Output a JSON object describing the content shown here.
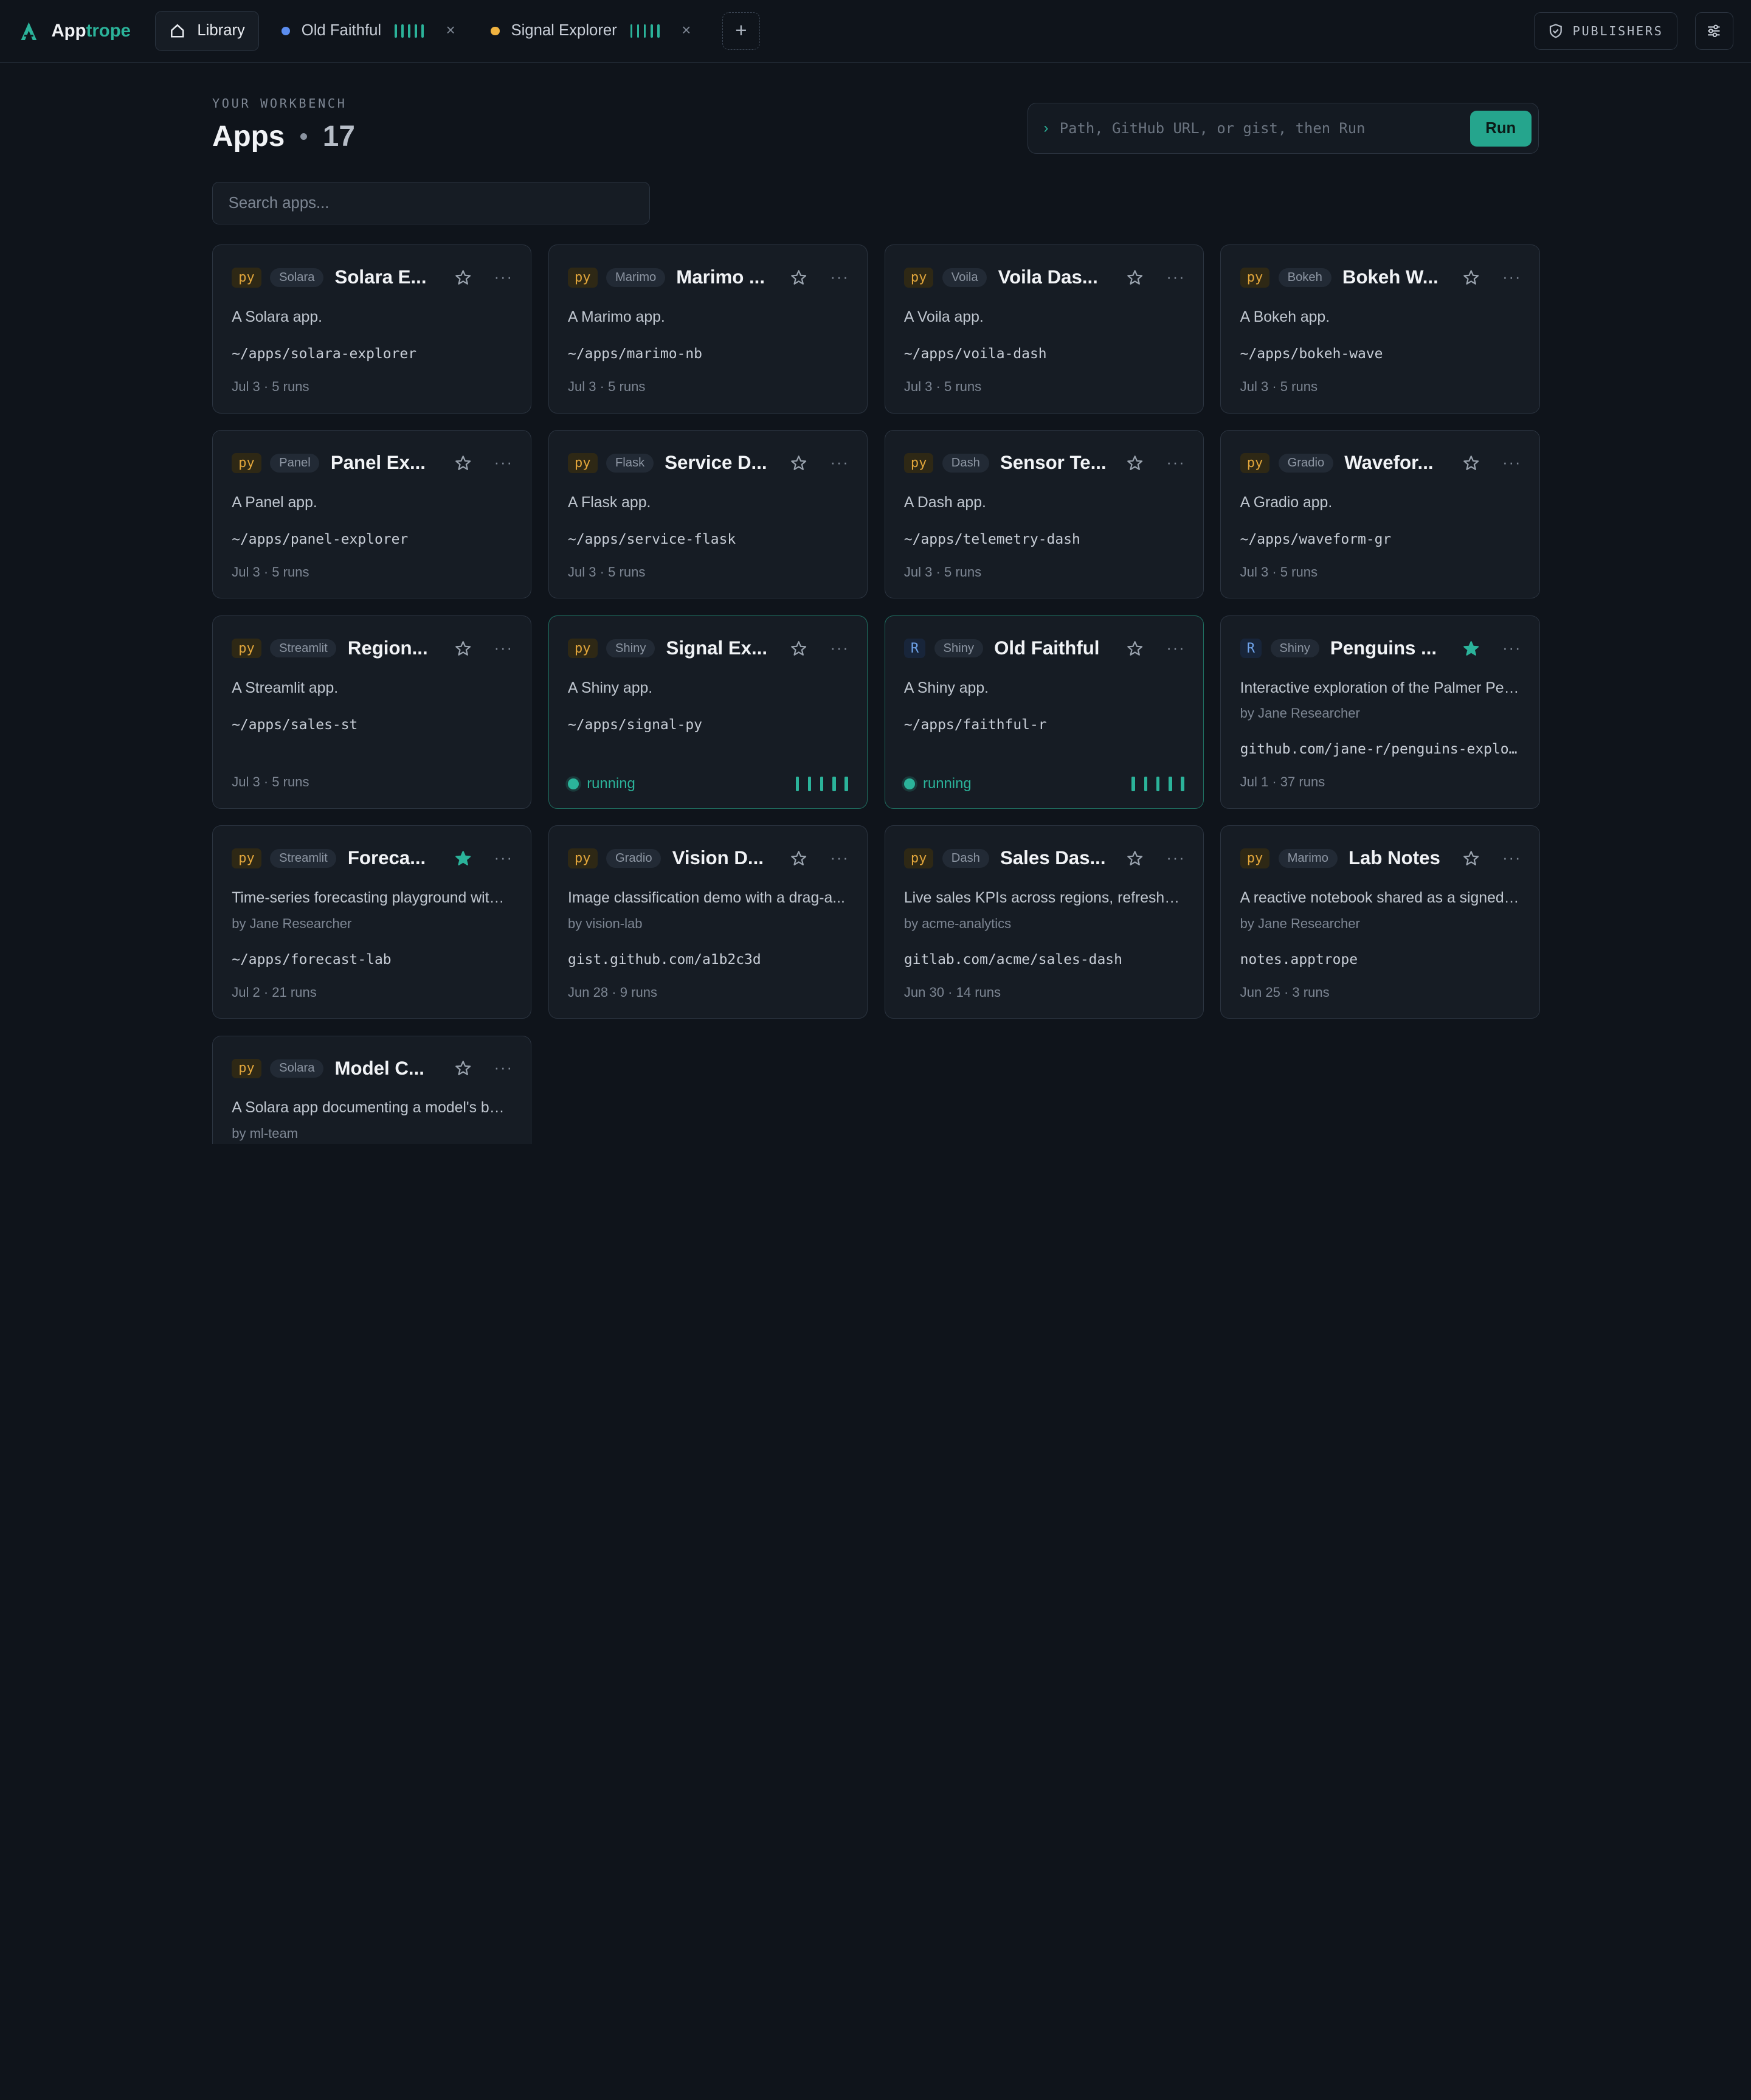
{
  "brand": {
    "name_prefix": "App",
    "name_accent": "trope"
  },
  "tabs": [
    {
      "label": "Library",
      "kind": "home"
    },
    {
      "label": "Old Faithful",
      "dot_color": "#5b8def",
      "close": "×"
    },
    {
      "label": "Signal Explorer",
      "dot_color": "#f0b340",
      "close": "×"
    }
  ],
  "tab_add": "+",
  "publishers_label": "PUBLISHERS",
  "header": {
    "eyebrow": "YOUR WORKBENCH",
    "title": "Apps",
    "count": "17"
  },
  "runbox": {
    "prompt": "›",
    "placeholder": "Path, GitHub URL, or gist, then Run",
    "button": "Run"
  },
  "search": {
    "placeholder": "Search apps..."
  },
  "colors": {
    "accent": "#2bb39a",
    "py": "#e2a63b",
    "r": "#6fa3ea"
  },
  "cards": [
    {
      "lang": "py",
      "framework": "Solara",
      "title": "Solara E...",
      "starred": false,
      "desc": "A Solara app.",
      "path": "~/apps/solara-explorer",
      "meta": "Jul 3 · 5 runs"
    },
    {
      "lang": "py",
      "framework": "Marimo",
      "title": "Marimo ...",
      "starred": false,
      "desc": "A Marimo app.",
      "path": "~/apps/marimo-nb",
      "meta": "Jul 3 · 5 runs"
    },
    {
      "lang": "py",
      "framework": "Voila",
      "title": "Voila Das...",
      "starred": false,
      "desc": "A Voila app.",
      "path": "~/apps/voila-dash",
      "meta": "Jul 3 · 5 runs"
    },
    {
      "lang": "py",
      "framework": "Bokeh",
      "title": "Bokeh W...",
      "starred": false,
      "desc": "A Bokeh app.",
      "path": "~/apps/bokeh-wave",
      "meta": "Jul 3 · 5 runs"
    },
    {
      "lang": "py",
      "framework": "Panel",
      "title": "Panel Ex...",
      "starred": false,
      "desc": "A Panel app.",
      "path": "~/apps/panel-explorer",
      "meta": "Jul 3 · 5 runs"
    },
    {
      "lang": "py",
      "framework": "Flask",
      "title": "Service D...",
      "starred": false,
      "desc": "A Flask app.",
      "path": "~/apps/service-flask",
      "meta": "Jul 3 · 5 runs"
    },
    {
      "lang": "py",
      "framework": "Dash",
      "title": "Sensor Te...",
      "starred": false,
      "desc": "A Dash app.",
      "path": "~/apps/telemetry-dash",
      "meta": "Jul 3 · 5 runs"
    },
    {
      "lang": "py",
      "framework": "Gradio",
      "title": "Wavefor...",
      "starred": false,
      "desc": "A Gradio app.",
      "path": "~/apps/waveform-gr",
      "meta": "Jul 3 · 5 runs"
    },
    {
      "lang": "py",
      "framework": "Streamlit",
      "title": "Region...",
      "starred": false,
      "desc": "A Streamlit app.",
      "path": "~/apps/sales-st",
      "meta": "Jul 3 · 5 runs"
    },
    {
      "lang": "py",
      "framework": "Shiny",
      "title": "Signal Ex...",
      "starred": false,
      "desc": "A Shiny app.",
      "path": "~/apps/signal-py",
      "status": "running"
    },
    {
      "lang": "R",
      "framework": "Shiny",
      "title": "Old Faithful",
      "starred": false,
      "desc": "A Shiny app.",
      "path": "~/apps/faithful-r",
      "status": "running"
    },
    {
      "lang": "R",
      "framework": "Shiny",
      "title": "Penguins ...",
      "starred": true,
      "desc": "Interactive exploration of the Palmer Pen...",
      "author": "by Jane Researcher",
      "path": "github.com/jane-r/penguins-explo...",
      "meta": "Jul 1 · 37 runs"
    },
    {
      "lang": "py",
      "framework": "Streamlit",
      "title": "Foreca...",
      "starred": true,
      "desc": "Time-series forecasting playground with ...",
      "author": "by Jane Researcher",
      "path": "~/apps/forecast-lab",
      "meta": "Jul 2 · 21 runs"
    },
    {
      "lang": "py",
      "framework": "Gradio",
      "title": "Vision D...",
      "starred": false,
      "desc": "Image classification demo with a drag-a...",
      "author": "by vision-lab",
      "path": "gist.github.com/a1b2c3d",
      "meta": "Jun 28 · 9 runs"
    },
    {
      "lang": "py",
      "framework": "Dash",
      "title": "Sales Das...",
      "starred": false,
      "desc": "Live sales KPIs across regions, refreshed...",
      "author": "by acme-analytics",
      "path": "gitlab.com/acme/sales-dash",
      "meta": "Jun 30 · 14 runs"
    },
    {
      "lang": "py",
      "framework": "Marimo",
      "title": "Lab Notes",
      "starred": false,
      "desc": "A reactive notebook shared as a signed b...",
      "author": "by Jane Researcher",
      "path": "notes.apptrope",
      "meta": "Jun 25 · 3 runs"
    },
    {
      "lang": "py",
      "framework": "Solara",
      "title": "Model C...",
      "starred": false,
      "desc": "A Solara app documenting a model's beh...",
      "author": "by ml-team"
    }
  ],
  "more_glyph": "···"
}
